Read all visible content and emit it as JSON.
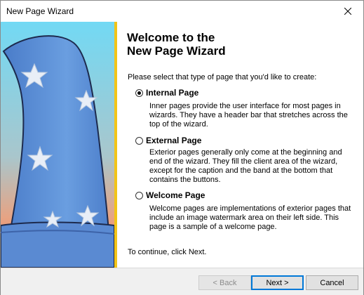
{
  "window": {
    "title": "New Page Wizard"
  },
  "heading": "Welcome to the\nNew Page Wizard",
  "prompt": "Please select that type of page that you'd like to create:",
  "options": [
    {
      "label": "Internal Page",
      "checked": true,
      "description": "Inner pages provide the user interface for most pages in wizards.  They have a header bar that stretches across the top of the wizard."
    },
    {
      "label": "External Page",
      "checked": false,
      "description": "Exterior pages generally only come at the beginning and end of the wizard.  They fill the client area of the wizard, except for the caption and the band at the bottom that contains the buttons."
    },
    {
      "label": "Welcome Page",
      "checked": false,
      "description": "Welcome pages are implementations of exterior pages that include an image watermark area on their left side.  This page is a sample of a welcome page."
    }
  ],
  "continue_text": "To continue, click Next.",
  "buttons": {
    "back": "< Back",
    "next": "Next >",
    "cancel": "Cancel"
  },
  "colors": {
    "band": "#f2c418",
    "hat": "#5b8ed6",
    "sky": "#6fd8f2",
    "ground": "#f0845c",
    "focus": "#0078d7"
  },
  "icons": {
    "close": "close-icon",
    "watermark": "wizard-hat-image"
  }
}
